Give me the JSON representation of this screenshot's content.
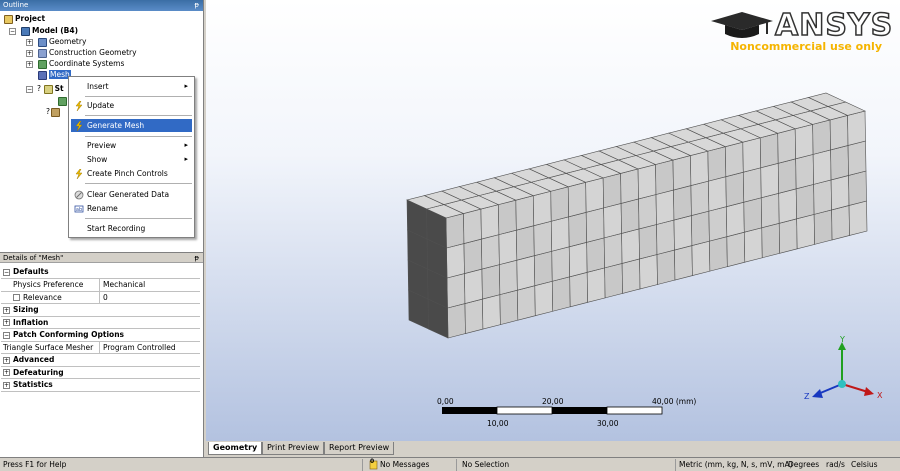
{
  "outline": {
    "title": "Outline",
    "pin": "ᵽ",
    "tree": {
      "project": "Project",
      "model": "Model (B4)",
      "geometry": "Geometry",
      "construction_geometry": "Construction Geometry",
      "coordinate_systems": "Coordinate Systems",
      "mesh": "Mesh",
      "static_structural": "St",
      "child_1": "?",
      "child_2": "?"
    }
  },
  "context_menu": {
    "items": [
      {
        "label": "Insert",
        "submenu": true
      },
      {
        "label": "Update",
        "icon": "lightning-icon"
      },
      {
        "label": "Generate Mesh",
        "icon": "lightning-icon",
        "highlighted": true
      },
      {
        "label": "Preview",
        "submenu": true
      },
      {
        "label": "Show",
        "submenu": true
      },
      {
        "label": "Create Pinch Controls",
        "icon": "lightning-icon"
      },
      {
        "label": "Clear Generated Data",
        "icon": "clear-icon"
      },
      {
        "label": "Rename",
        "icon": "rename-icon"
      },
      {
        "label": "Start Recording"
      }
    ]
  },
  "details": {
    "title": "Details of \"Mesh\"",
    "pin": "ᵽ",
    "rows": [
      {
        "type": "section",
        "label": "Defaults",
        "expanded": true
      },
      {
        "type": "prop",
        "key": "Physics Preference",
        "value": "Mechanical"
      },
      {
        "type": "prop",
        "key": "Relevance",
        "value": "0",
        "checkbox": true
      },
      {
        "type": "section",
        "label": "Sizing",
        "expanded": false
      },
      {
        "type": "section",
        "label": "Inflation",
        "expanded": false
      },
      {
        "type": "section",
        "label": "Patch Conforming Options",
        "expanded": true
      },
      {
        "type": "prop",
        "key": "Triangle Surface Mesher",
        "value": "Program Controlled"
      },
      {
        "type": "section",
        "label": "Advanced",
        "expanded": false
      },
      {
        "type": "section",
        "label": "Defeaturing",
        "expanded": false
      },
      {
        "type": "section",
        "label": "Statistics",
        "expanded": false
      }
    ]
  },
  "viewport": {
    "logo_text": "ANSYS",
    "logo_subtitle": "Noncommercial use only",
    "ruler": {
      "top_labels": [
        "0,00",
        "20,00",
        "40,00 (mm)"
      ],
      "bottom_labels": [
        "10,00",
        "30,00"
      ]
    },
    "triad": {
      "x": "X",
      "y": "Y",
      "z": "Z"
    },
    "mesh": {
      "elements_along_length": 24,
      "elements_through_height": 4,
      "elements_through_depth": 2
    }
  },
  "tabs": [
    "Geometry",
    "Print Preview",
    "Report Preview"
  ],
  "status": {
    "help": "Press F1 for Help",
    "messages_count": "0",
    "messages": "No Messages",
    "selection": "No Selection",
    "units": "Metric (mm, kg, N, s, mV, mA)",
    "angle": "Degrees",
    "angular_velocity": "rad/s",
    "temperature": "Celsius"
  },
  "colors": {
    "selection": "#316ac5",
    "logo_accent": "#f5b400",
    "mesh_face": "#c8c8c8",
    "mesh_dark": "#4a4a4a"
  }
}
